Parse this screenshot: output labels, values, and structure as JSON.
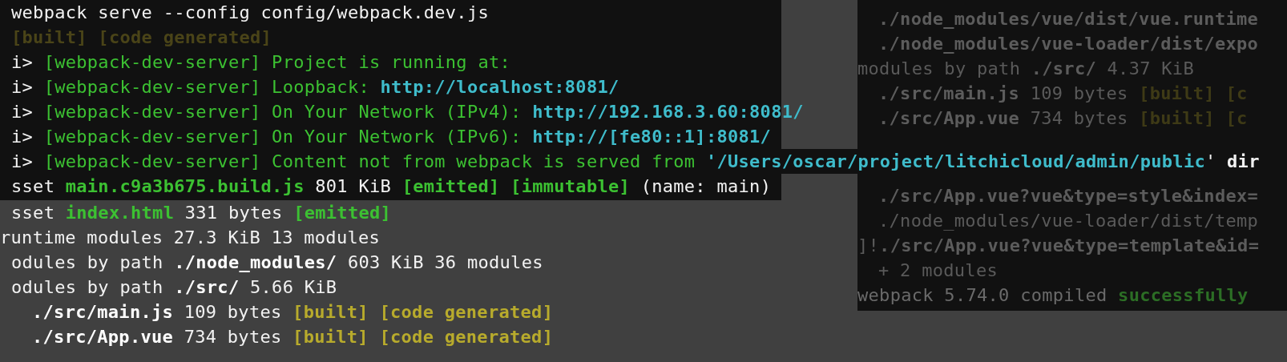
{
  "terminal": {
    "lines": [
      {
        "kind": "plain",
        "segments": [
          {
            "text": "webpack serve --config config/webpack.dev.js",
            "color": "#f2f2f2",
            "bold": false
          }
        ]
      },
      {
        "kind": "plain",
        "segments": [
          {
            "text": "[built] [code generated]",
            "color": "#4a4418",
            "bold": true
          }
        ]
      },
      {
        "kind": "plain",
        "segments": [
          {
            "text": "i> ",
            "color": "#f2f2f2",
            "bold": false
          },
          {
            "text": "[webpack-dev-server] Project is running at:",
            "color": "#3cc132",
            "bold": false
          }
        ]
      },
      {
        "kind": "plain",
        "segments": [
          {
            "text": "i> ",
            "color": "#f2f2f2",
            "bold": false
          },
          {
            "text": "[webpack-dev-server] Loopback: ",
            "color": "#3cc132",
            "bold": false
          },
          {
            "text": "http://localhost:8081/",
            "color": "#3fbccb",
            "bold": true
          }
        ]
      },
      {
        "kind": "plain",
        "segments": [
          {
            "text": "i> ",
            "color": "#f2f2f2",
            "bold": false
          },
          {
            "text": "[webpack-dev-server] On Your Network (IPv4): ",
            "color": "#3cc132",
            "bold": false
          },
          {
            "text": "http://192.168.3.60:8081/",
            "color": "#3fbccb",
            "bold": true
          }
        ]
      },
      {
        "kind": "plain",
        "segments": [
          {
            "text": "i> ",
            "color": "#f2f2f2",
            "bold": false
          },
          {
            "text": "[webpack-dev-server] On Your Network (IPv6): ",
            "color": "#3cc132",
            "bold": false
          },
          {
            "text": "http://[fe80::1]:8081/",
            "color": "#3fbccb",
            "bold": true
          }
        ]
      },
      {
        "kind": "wide",
        "segments": [
          {
            "text": "i> ",
            "color": "#f2f2f2",
            "bold": false
          },
          {
            "text": "[webpack-dev-server] Content not from webpack is served from ",
            "color": "#3cc132",
            "bold": false
          },
          {
            "text": "'/Users/oscar/project/litchicloud/admin/public",
            "color": "#3fbccb",
            "bold": true
          },
          {
            "text": "' ",
            "color": "#f2f2f2",
            "bold": false
          },
          {
            "text": "dir",
            "color": "#f2f2f2",
            "bold": true
          }
        ]
      },
      {
        "kind": "plain",
        "segments": [
          {
            "text": "sset ",
            "color": "#f2f2f2",
            "bold": false
          },
          {
            "text": "main.c9a3b675.build.js",
            "color": "#3cc132",
            "bold": true
          },
          {
            "text": " 801 KiB ",
            "color": "#f2f2f2",
            "bold": false
          },
          {
            "text": "[emitted] [immutable]",
            "color": "#3cc132",
            "bold": true
          },
          {
            "text": " (name: main)",
            "color": "#f2f2f2",
            "bold": false
          }
        ]
      }
    ],
    "lower_lines": [
      {
        "kind": "plain",
        "segments": [
          {
            "text": "sset ",
            "color": "#f2f2f2",
            "bold": false
          },
          {
            "text": "index.html",
            "color": "#3cc132",
            "bold": true
          },
          {
            "text": " 331 bytes ",
            "color": "#f2f2f2",
            "bold": false
          },
          {
            "text": "[emitted]",
            "color": "#3cc132",
            "bold": true
          }
        ]
      },
      {
        "kind": "edge",
        "segments": [
          {
            "text": "runtime modules 27.3 KiB 13 modules",
            "color": "#f2f2f2",
            "bold": false
          }
        ]
      },
      {
        "kind": "plain",
        "segments": [
          {
            "text": "odules by path ",
            "color": "#f2f2f2",
            "bold": false
          },
          {
            "text": "./node_modules/",
            "color": "#ffffff",
            "bold": true
          },
          {
            "text": " 603 KiB 36 modules",
            "color": "#f2f2f2",
            "bold": false
          }
        ]
      },
      {
        "kind": "plain",
        "segments": [
          {
            "text": "odules by path ",
            "color": "#f2f2f2",
            "bold": false
          },
          {
            "text": "./src/",
            "color": "#ffffff",
            "bold": true
          },
          {
            "text": " 5.66 KiB",
            "color": "#f2f2f2",
            "bold": false
          }
        ]
      },
      {
        "kind": "nested",
        "segments": [
          {
            "text": "./src/main.js",
            "color": "#ffffff",
            "bold": true
          },
          {
            "text": " 109 bytes ",
            "color": "#f2f2f2",
            "bold": false
          },
          {
            "text": "[built] [code generated]",
            "color": "#b8ab2c",
            "bold": true
          }
        ]
      },
      {
        "kind": "nested",
        "segments": [
          {
            "text": "./src/App.vue",
            "color": "#ffffff",
            "bold": true
          },
          {
            "text": " 734 bytes ",
            "color": "#f2f2f2",
            "bold": false
          },
          {
            "text": "[built] [code generated]",
            "color": "#b8ab2c",
            "bold": true
          }
        ]
      }
    ]
  },
  "background_terminal": {
    "upper_lines": [
      {
        "kind": "nested",
        "segments": [
          {
            "text": "./node_modules/vue/dist/vue.runtime",
            "color": "#5c5c5c",
            "bold": true
          }
        ]
      },
      {
        "kind": "nested",
        "segments": [
          {
            "text": "./node_modules/vue-loader/dist/expo",
            "color": "#5c5c5c",
            "bold": true
          }
        ]
      },
      {
        "kind": "plain",
        "segments": [
          {
            "text": "modules by path ",
            "color": "#5a5a5a",
            "bold": false
          },
          {
            "text": "./src/",
            "color": "#5c5c5c",
            "bold": true
          },
          {
            "text": " 4.37 KiB",
            "color": "#5a5a5a",
            "bold": false
          }
        ]
      },
      {
        "kind": "nested",
        "segments": [
          {
            "text": "./src/main.js",
            "color": "#5c5c5c",
            "bold": true
          },
          {
            "text": " 109 bytes ",
            "color": "#5a5a5a",
            "bold": false
          },
          {
            "text": "[built] [c",
            "color": "#3e3a16",
            "bold": true
          }
        ]
      },
      {
        "kind": "nested",
        "segments": [
          {
            "text": "./src/App.vue",
            "color": "#5c5c5c",
            "bold": true
          },
          {
            "text": " 734 bytes ",
            "color": "#5a5a5a",
            "bold": false
          },
          {
            "text": "[built] [c",
            "color": "#3e3a16",
            "bold": true
          }
        ]
      }
    ],
    "lower_lines": [
      {
        "kind": "nested",
        "segments": [
          {
            "text": "./src/App.vue?vue&type=style&index=",
            "color": "#5c5c5c",
            "bold": true
          }
        ]
      },
      {
        "kind": "nested",
        "segments": [
          {
            "text": "./node_modules/vue-loader/dist/temp",
            "color": "#5a5a5a",
            "bold": false
          }
        ]
      },
      {
        "kind": "plain",
        "segments": [
          {
            "text": "]!",
            "color": "#5a5a5a",
            "bold": false
          },
          {
            "text": "./src/App.vue?vue&type=template&id=",
            "color": "#5c5c5c",
            "bold": true
          }
        ]
      },
      {
        "kind": "nested",
        "segments": [
          {
            "text": "+ 2 modules",
            "color": "#5a5a5a",
            "bold": false
          }
        ]
      },
      {
        "kind": "plain",
        "segments": [
          {
            "text": "webpack 5.74.0 compiled ",
            "color": "#6a6a6a",
            "bold": false
          },
          {
            "text": "successfully",
            "color": "#2c6e25",
            "bold": true
          }
        ]
      }
    ]
  }
}
